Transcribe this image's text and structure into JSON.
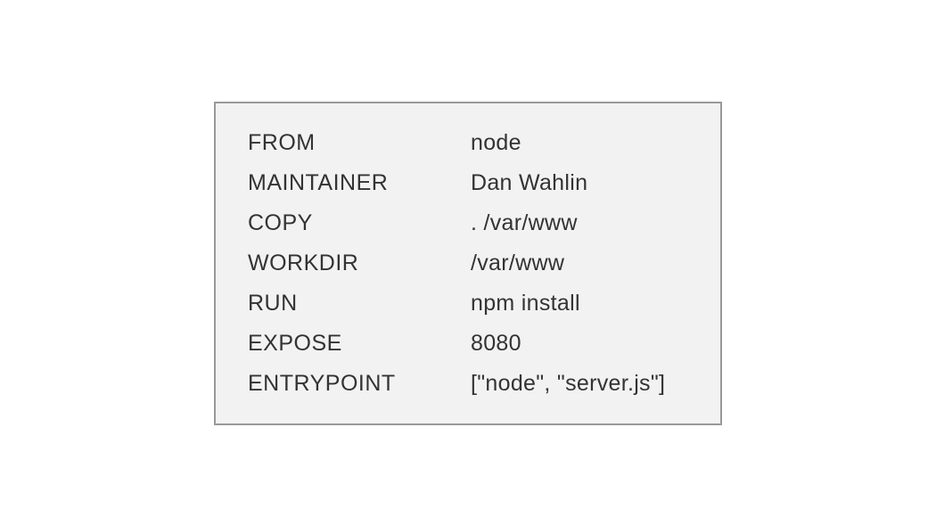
{
  "dockerfile": {
    "rows": [
      {
        "instruction": "FROM",
        "value": "node"
      },
      {
        "instruction": "MAINTAINER",
        "value": "Dan Wahlin"
      },
      {
        "instruction": "COPY",
        "value": ".  /var/www"
      },
      {
        "instruction": "WORKDIR",
        "value": "/var/www"
      },
      {
        "instruction": "RUN",
        "value": "npm install"
      },
      {
        "instruction": "EXPOSE",
        "value": "8080"
      },
      {
        "instruction": "ENTRYPOINT",
        "value": "[\"node\", \"server.js\"]"
      }
    ]
  }
}
